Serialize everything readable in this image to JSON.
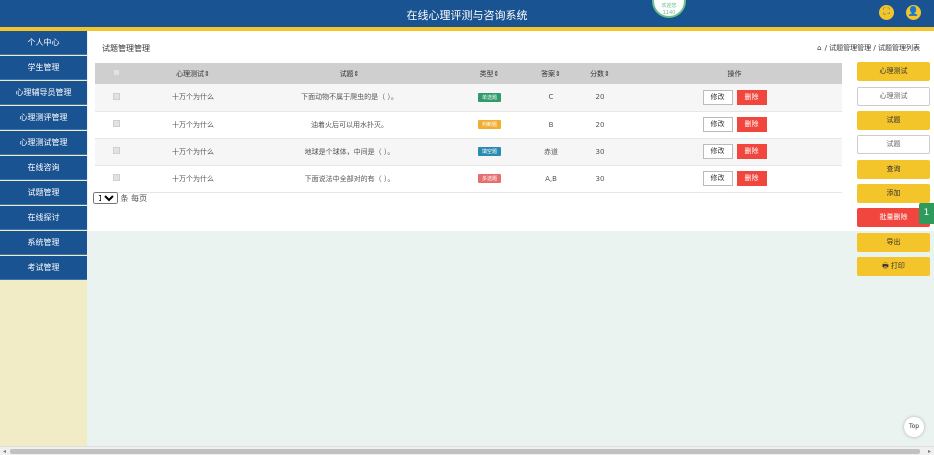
{
  "header": {
    "title": "在线心理评测与咨询系统",
    "user_badge": [
      "欢迎您",
      "1140"
    ],
    "fullscreen_icon": "⛶",
    "user_icon": "👤"
  },
  "sidebar": {
    "items": [
      "个人中心",
      "学生管理",
      "心理辅导员管理",
      "心理测评管理",
      "心理测试管理",
      "在线咨询",
      "试题管理",
      "在线探讨",
      "系统管理",
      "考试管理"
    ]
  },
  "page": {
    "title": "试题管理管理",
    "breadcrumb": "/ 试题管理管理 / 试题管理列表"
  },
  "table": {
    "headers": [
      "心理测试⇕",
      "试题⇕",
      "类型⇕",
      "答案⇕",
      "分数⇕",
      "操作"
    ],
    "rows": [
      {
        "test": "十万个为什么",
        "question": "下面动物不属于爬虫的是（ ）。",
        "type": "单选题",
        "type_color": "#2f9a6b",
        "answer": "C",
        "score": "20"
      },
      {
        "test": "十万个为什么",
        "question": "油着火后可以用水扑灭。",
        "type": "判断题",
        "type_color": "#f0ad2e",
        "answer": "B",
        "score": "20"
      },
      {
        "test": "十万个为什么",
        "question": "地球是个球体，中间是（ ）。",
        "type": "填空题",
        "type_color": "#2a8bb0",
        "answer": "赤道",
        "score": "30"
      },
      {
        "test": "十万个为什么",
        "question": "下面说法中全部对的有（ ）。",
        "type": "多选题",
        "type_color": "#e76e6e",
        "answer": "A,B",
        "score": "30"
      }
    ],
    "edit_label": "修改",
    "delete_label": "删除"
  },
  "pager": {
    "page_size": "10",
    "suffix": "条 每页"
  },
  "actions": {
    "test_button": "心理测试",
    "test_input_placeholder": "心理测试",
    "question_button": "试题",
    "question_input_placeholder": "试题",
    "search_button": "查询",
    "add_button": "添加",
    "batch_delete_button": "批量删除",
    "export_button": "导出",
    "print_button": "打印"
  },
  "side_tab": "1",
  "top_button": "Top"
}
